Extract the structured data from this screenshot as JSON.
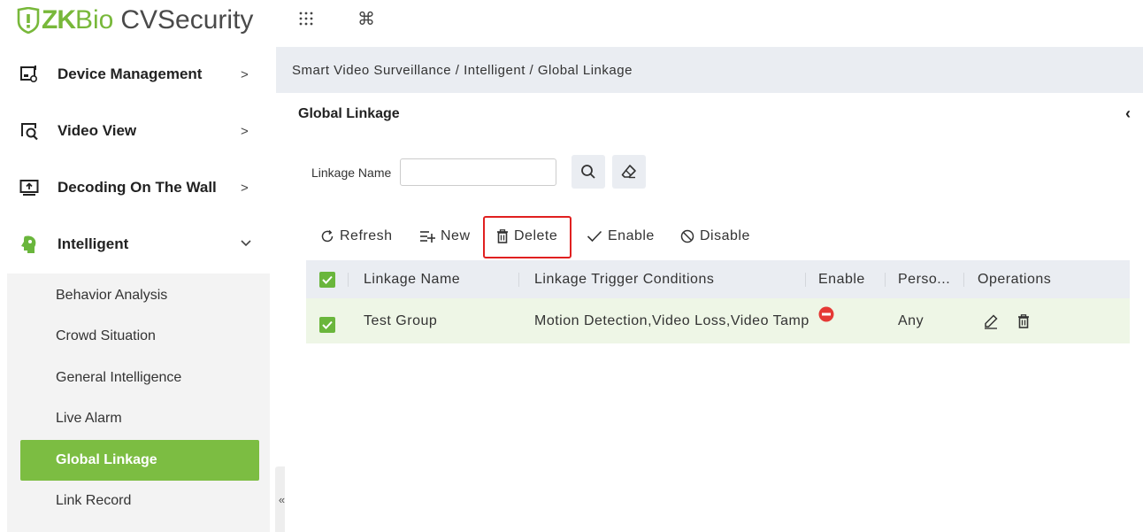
{
  "app": {
    "logo_part1": "ZK",
    "logo_part2": "Bio",
    "logo_part3": "CVSecurity",
    "header_icons": [
      "apps-grid-icon",
      "command-icon"
    ]
  },
  "sidebar": {
    "top_items": [
      {
        "label": "Device Management",
        "icon": "device-management-icon",
        "arrow": ">"
      },
      {
        "label": "Video View",
        "icon": "video-view-icon",
        "arrow": ">"
      },
      {
        "label": "Decoding On The Wall",
        "icon": "decoding-wall-icon",
        "arrow": ">"
      },
      {
        "label": "Intelligent",
        "icon": "intelligent-icon",
        "arrow": "⌄"
      }
    ],
    "sub_items": [
      {
        "label": "Behavior Analysis"
      },
      {
        "label": "Crowd Situation"
      },
      {
        "label": "General Intelligence"
      },
      {
        "label": "Live Alarm"
      },
      {
        "label": "Global Linkage",
        "active": true
      },
      {
        "label": "Link Record"
      }
    ],
    "collapse_label": "«"
  },
  "breadcrumb": "Smart Video Surveillance / Intelligent / Global Linkage",
  "panel": {
    "title": "Global Linkage",
    "back_icon": "‹"
  },
  "search": {
    "label": "Linkage Name",
    "value": "",
    "placeholder": ""
  },
  "toolbar": {
    "refresh": "Refresh",
    "new": "New",
    "delete": "Delete",
    "enable": "Enable",
    "disable": "Disable"
  },
  "table": {
    "headers": {
      "name": "Linkage Name",
      "conditions": "Linkage Trigger Conditions",
      "enable": "Enable",
      "person": "Perso...",
      "operations": "Operations"
    },
    "rows": [
      {
        "name": "Test Group",
        "conditions": "Motion Detection,Video Loss,Video Tampering",
        "enable_status": "disabled",
        "person": "Any",
        "checked": true
      }
    ]
  },
  "colors": {
    "brand_green": "#78b83a",
    "active_green": "#7cbd42",
    "checkbox_green": "#6ab63c",
    "highlight_red": "#e02020",
    "status_red": "#e53935"
  }
}
